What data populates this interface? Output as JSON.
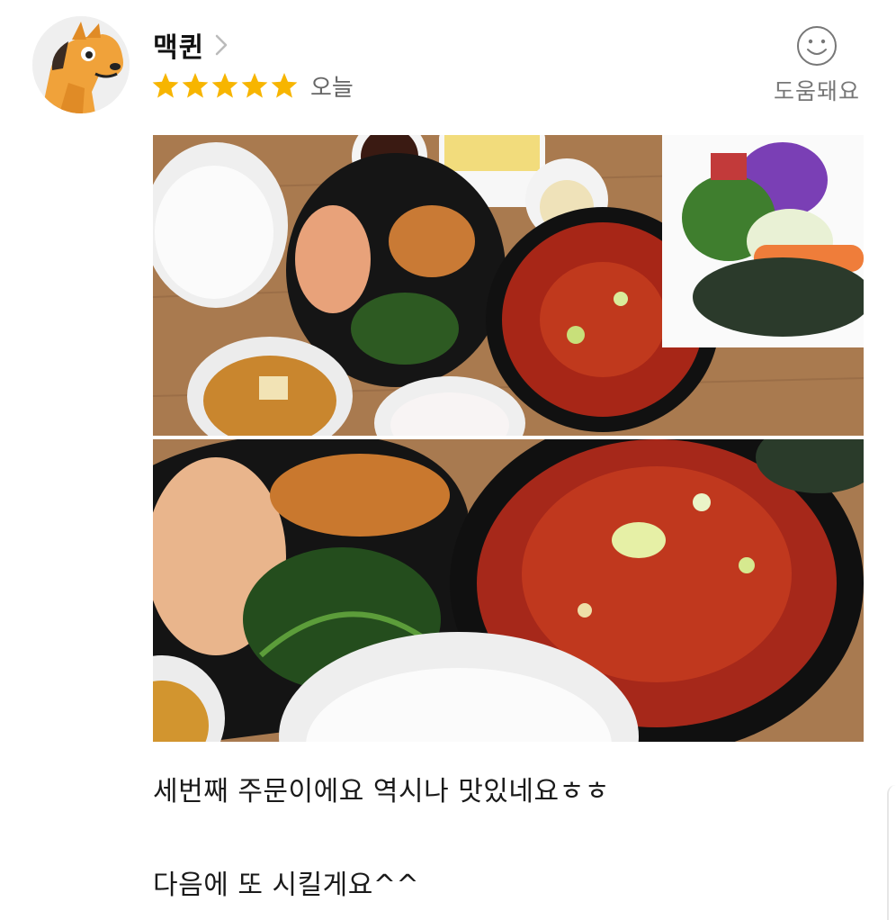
{
  "review": {
    "user": {
      "name": "맥퀸",
      "avatar_icon": "horse-avatar-icon",
      "chevron_icon": "chevron-right-icon"
    },
    "rating": {
      "stars": 5,
      "max": 5,
      "star_color": "#f7b500",
      "star_icon": "star-icon"
    },
    "date": "오늘",
    "helpful": {
      "label": "도움돼요",
      "icon": "smile-icon"
    },
    "photos": [
      {
        "subject": "food-photo"
      },
      {
        "subject": "food-photo"
      }
    ],
    "text_lines": [
      "세번째 주문이에요 역시나 맛있네요ㅎㅎ",
      "다음에 또 시킬게요^^"
    ]
  }
}
